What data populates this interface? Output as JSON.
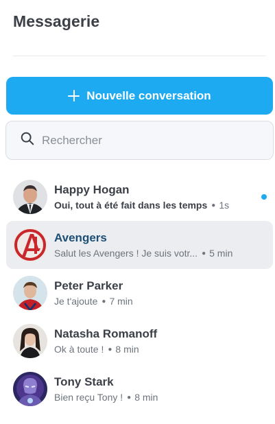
{
  "header": {
    "title": "Messagerie"
  },
  "new_conversation": {
    "label": "Nouvelle conversation",
    "icon": "plus-icon"
  },
  "search": {
    "placeholder": "Rechercher",
    "value": "",
    "icon": "search-icon"
  },
  "accent_color": "#1eaaf1",
  "conversations": [
    {
      "name": "Happy Hogan",
      "preview": "Oui, tout à été fait dans les temps",
      "time": "1s",
      "unread": true,
      "active": false,
      "avatar": "avatar-happy-hogan"
    },
    {
      "name": "Avengers",
      "preview": "Salut les Avengers ! Je suis votr...",
      "time": "5 min",
      "unread": false,
      "active": true,
      "avatar": "avatar-avengers-logo"
    },
    {
      "name": "Peter Parker",
      "preview": "Je t'ajoute",
      "time": "7 min",
      "unread": false,
      "active": false,
      "avatar": "avatar-peter-parker"
    },
    {
      "name": "Natasha Romanoff",
      "preview": "Ok à toute !",
      "time": "8 min",
      "unread": false,
      "active": false,
      "avatar": "avatar-natasha-romanoff"
    },
    {
      "name": "Tony Stark",
      "preview": "Bien reçu Tony !",
      "time": "8 min",
      "unread": false,
      "active": false,
      "avatar": "avatar-tony-stark"
    }
  ]
}
